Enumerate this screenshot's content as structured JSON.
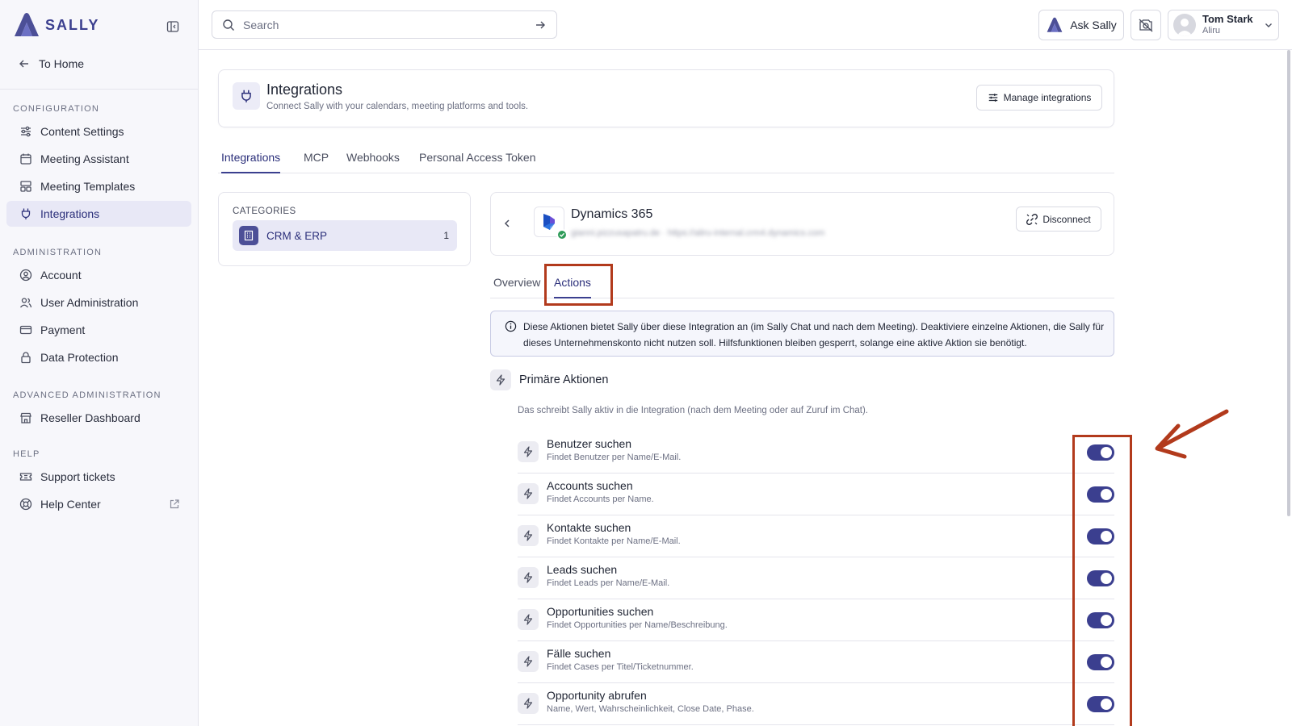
{
  "brand": {
    "name": "SALLY"
  },
  "sidebar": {
    "home": "To Home",
    "sections": [
      {
        "label": "CONFIGURATION",
        "items": [
          {
            "label": "Content Settings",
            "icon": "sliders-icon"
          },
          {
            "label": "Meeting Assistant",
            "icon": "calendar-icon"
          },
          {
            "label": "Meeting Templates",
            "icon": "template-icon"
          },
          {
            "label": "Integrations",
            "icon": "plug-icon",
            "active": true
          }
        ]
      },
      {
        "label": "ADMINISTRATION",
        "items": [
          {
            "label": "Account",
            "icon": "user-circle-icon"
          },
          {
            "label": "User Administration",
            "icon": "users-icon"
          },
          {
            "label": "Payment",
            "icon": "credit-card-icon"
          },
          {
            "label": "Data Protection",
            "icon": "lock-icon"
          }
        ]
      },
      {
        "label": "ADVANCED ADMINISTRATION",
        "items": [
          {
            "label": "Reseller Dashboard",
            "icon": "store-icon"
          }
        ]
      },
      {
        "label": "HELP",
        "items": [
          {
            "label": "Support tickets",
            "icon": "ticket-icon"
          },
          {
            "label": "Help Center",
            "icon": "lifebuoy-icon",
            "external": true
          }
        ]
      }
    ]
  },
  "topbar": {
    "search_placeholder": "Search",
    "ask_label": "Ask Sally",
    "user_name": "Tom Stark",
    "user_org": "Aliru"
  },
  "header": {
    "title": "Integrations",
    "subtitle": "Connect Sally with your calendars, meeting platforms and tools.",
    "manage_label": "Manage integrations"
  },
  "tabs": [
    "Integrations",
    "MCP",
    "Webhooks",
    "Personal Access Token"
  ],
  "categories": {
    "label": "CATEGORIES",
    "items": [
      {
        "label": "CRM & ERP",
        "count": "1"
      }
    ]
  },
  "integration": {
    "title": "Dynamics 365",
    "blurred": "gianni.pizzusapatru.de · https://aliru-internal.crm4.dynamics.com",
    "disconnect_label": "Disconnect"
  },
  "subtabs": [
    "Overview",
    "Actions"
  ],
  "info_text": "Diese Aktionen bietet Sally über diese Integration an (im Sally Chat und nach dem Meeting). Deaktiviere einzelne Aktionen, die Sally für dieses Unternehmenskonto nicht nutzen soll. Hilfsfunktionen bleiben gesperrt, solange eine aktive Aktion sie benötigt.",
  "primary": {
    "title": "Primäre Aktionen",
    "desc": "Das schreibt Sally aktiv in die Integration (nach dem Meeting oder auf Zuruf im Chat).",
    "actions": [
      {
        "title": "Benutzer suchen",
        "desc": "Findet Benutzer per Name/E-Mail.",
        "enabled": true
      },
      {
        "title": "Accounts suchen",
        "desc": "Findet Accounts per Name.",
        "enabled": true
      },
      {
        "title": "Kontakte suchen",
        "desc": "Findet Kontakte per Name/E-Mail.",
        "enabled": true
      },
      {
        "title": "Leads suchen",
        "desc": "Findet Leads per Name/E-Mail.",
        "enabled": true
      },
      {
        "title": "Opportunities suchen",
        "desc": "Findet Opportunities per Name/Beschreibung.",
        "enabled": true
      },
      {
        "title": "Fälle suchen",
        "desc": "Findet Cases per Titel/Ticketnummer.",
        "enabled": true
      },
      {
        "title": "Opportunity abrufen",
        "desc": "Name, Wert, Wahrscheinlichkeit, Close Date, Phase.",
        "enabled": true
      }
    ]
  },
  "colors": {
    "accent": "#3b3f8f",
    "annotation": "#b23a1c",
    "success": "#2e9b58"
  }
}
